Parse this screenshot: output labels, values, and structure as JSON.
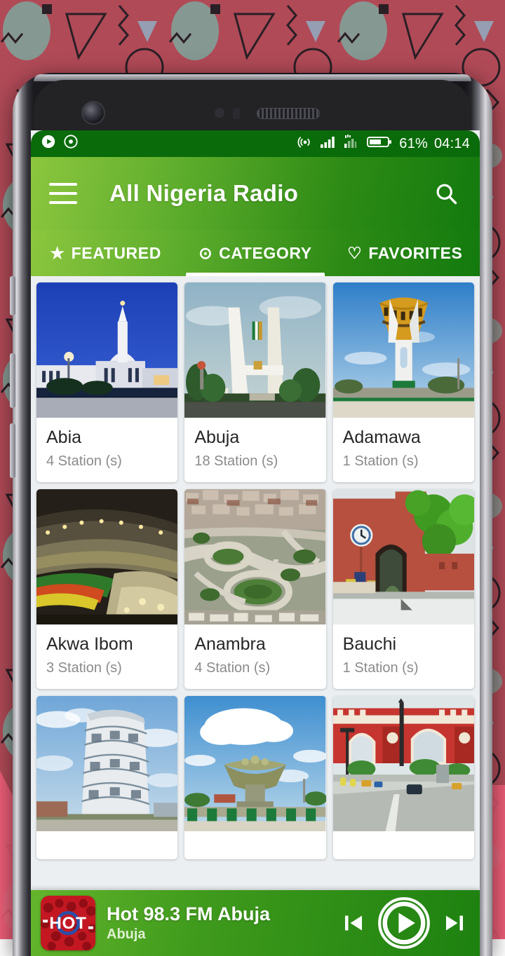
{
  "status_bar": {
    "left_icons": [
      "play-circle-icon",
      "record-circle-icon"
    ],
    "right_icons": [
      "hotspot-icon",
      "signal-bars-icon",
      "signal-data-icon",
      "battery-icon"
    ],
    "battery_percent": "61%",
    "clock": "04:14"
  },
  "app_bar": {
    "menu_icon": "hamburger-menu-icon",
    "title": "All Nigeria Radio",
    "search_icon": "search-icon"
  },
  "tabs": [
    {
      "label": "FEATURED",
      "icon": "star-icon",
      "glyph": "★",
      "active": false
    },
    {
      "label": "CATEGORY",
      "icon": "target-icon",
      "glyph": "⊙",
      "active": true
    },
    {
      "label": "FAVORITES",
      "icon": "heart-icon",
      "glyph": "♡",
      "active": false
    }
  ],
  "categories": [
    {
      "name": "Abia",
      "stations": "4 Station (s)",
      "image": "abia-state-building-photo"
    },
    {
      "name": "Abuja",
      "stations": "18 Station (s)",
      "image": "abuja-city-gate-photo"
    },
    {
      "name": "Adamawa",
      "stations": "1 Station (s)",
      "image": "adamawa-monument-photo"
    },
    {
      "name": "Akwa Ibom",
      "stations": "3 Station (s)",
      "image": "akwa-ibom-stadium-photo"
    },
    {
      "name": "Anambra",
      "stations": "4 Station (s)",
      "image": "anambra-interchange-photo"
    },
    {
      "name": "Bauchi",
      "stations": "1 Station (s)",
      "image": "bauchi-red-arch-photo"
    },
    {
      "name": "",
      "stations": "",
      "image": "bayelsa-curved-tower-photo"
    },
    {
      "name": "",
      "stations": "",
      "image": "benue-bowl-monument-photo"
    },
    {
      "name": "",
      "stations": "",
      "image": "borno-red-gate-photo"
    }
  ],
  "player": {
    "artwork": "hot-fm-album-art",
    "title": "Hot 98.3 FM Abuja",
    "subtitle": "Abuja",
    "previous_icon": "skip-previous-icon",
    "play_icon": "play-icon",
    "next_icon": "skip-next-icon"
  },
  "colors": {
    "brand_green_light": "#8cc63e",
    "brand_green_dark": "#137a0e",
    "status_bar_green": "#0a6b0a",
    "background_red": "#b04a57",
    "card_surface": "#ffffff",
    "content_background": "#eceff1"
  }
}
